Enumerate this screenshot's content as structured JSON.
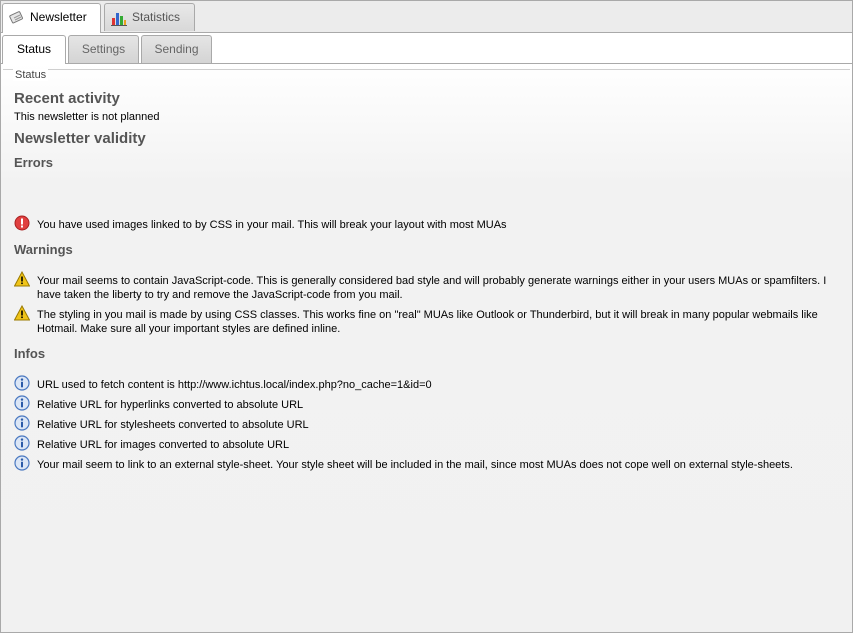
{
  "top_tabs": [
    {
      "label": "Newsletter",
      "icon": "newsletter-icon",
      "active": true
    },
    {
      "label": "Statistics",
      "icon": "bar-chart-icon",
      "active": false
    }
  ],
  "sub_tabs": [
    {
      "label": "Status",
      "active": true
    },
    {
      "label": "Settings",
      "active": false
    },
    {
      "label": "Sending",
      "active": false
    }
  ],
  "status": {
    "legend": "Status",
    "recent_activity_title": "Recent activity",
    "recent_activity_text": "This newsletter is not planned",
    "validity_title": "Newsletter validity",
    "errors_title": "Errors",
    "errors": [
      "You have used images linked to by CSS in your mail. This will break your layout with most MUAs"
    ],
    "warnings_title": "Warnings",
    "warnings": [
      "Your mail seems to contain JavaScript-code. This is generally considered bad style and will probably generate warnings either in your users MUAs or spamfilters. I have taken the liberty to try and remove the JavaScript-code from you mail.",
      "The styling in you mail is made by using CSS classes. This works fine on \"real\" MUAs like Outlook or Thunderbird, but it will break in many popular webmails like Hotmail. Make sure all your important styles are defined inline."
    ],
    "infos_title": "Infos",
    "infos": [
      "URL used to fetch content is http://www.ichtus.local/index.php?no_cache=1&id=0",
      "Relative URL for hyperlinks converted to absolute URL",
      "Relative URL for stylesheets converted to absolute URL",
      "Relative URL for images converted to absolute URL",
      "Your mail seem to link to an external style-sheet. Your style sheet will be included in the mail, since most MUAs does not cope well on external style-sheets."
    ]
  },
  "colors": {
    "error": "#e04040",
    "warning": "#f0c419",
    "info": "#4a78c0"
  }
}
